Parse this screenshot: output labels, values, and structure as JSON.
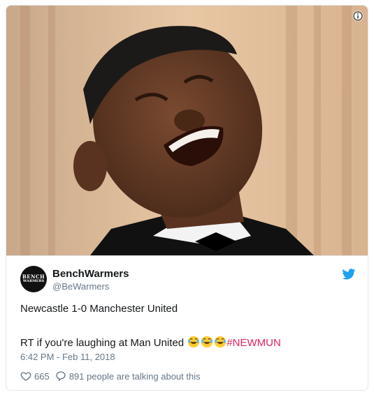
{
  "tweet": {
    "author_name": "BenchWarmers",
    "author_handle": "@BeWarmers",
    "avatar_text_line1": "BENCH",
    "avatar_text_line2": "WARMERS",
    "line1": "Newcastle 1-0 Manchester United",
    "line2": "RT if you're laughing at Man United ",
    "hashtag": "#NEWMUN",
    "timestamp": "6:42 PM - Feb 11, 2018",
    "likes": "665",
    "talking": "891 people are talking about this"
  },
  "icons": [
    "info-icon",
    "twitter-bird-icon",
    "heart-icon",
    "comment-icon",
    "laughing-emoji-icon"
  ],
  "colors": {
    "twitter_blue": "#1da1f2",
    "hashtag": "#e0245e",
    "muted": "#657786"
  }
}
